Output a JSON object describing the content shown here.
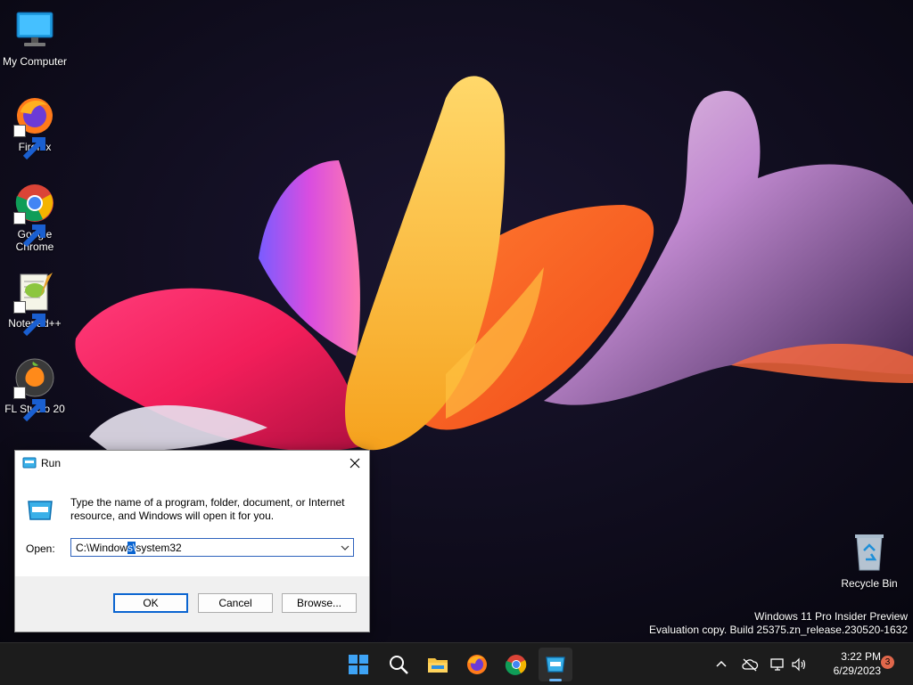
{
  "desktop": {
    "icons": [
      {
        "label": "My Computer"
      },
      {
        "label": "Firefox"
      },
      {
        "label": "Google Chrome"
      },
      {
        "label": "Notepad++"
      },
      {
        "label": "FL Studio 20"
      },
      {
        "label": "Recycle Bin"
      }
    ],
    "watermark": {
      "line1": "Windows 11 Pro Insider Preview",
      "line2": "Evaluation copy. Build 25375.zn_release.230520-1632"
    }
  },
  "run_dialog": {
    "title": "Run",
    "description": "Type the name of a program, folder, document, or Internet resource, and Windows will open it for you.",
    "open_label": "Open:",
    "open_value_before": "C:\\Window",
    "open_value_selected": "s\\",
    "open_value_after": "system32",
    "buttons": {
      "ok": "OK",
      "cancel": "Cancel",
      "browse": "Browse..."
    }
  },
  "taskbar": {
    "apps": [
      "start-icon",
      "search-icon",
      "file-explorer-icon",
      "firefox-icon",
      "chrome-icon",
      "run-icon"
    ],
    "active_app": "run",
    "clock": {
      "time": "3:22 PM",
      "date": "6/29/2023"
    },
    "notification_count": "3"
  },
  "colors": {
    "accent": "#0a64d0",
    "taskbar": "#1c1c1c",
    "badge": "#e0674b"
  }
}
